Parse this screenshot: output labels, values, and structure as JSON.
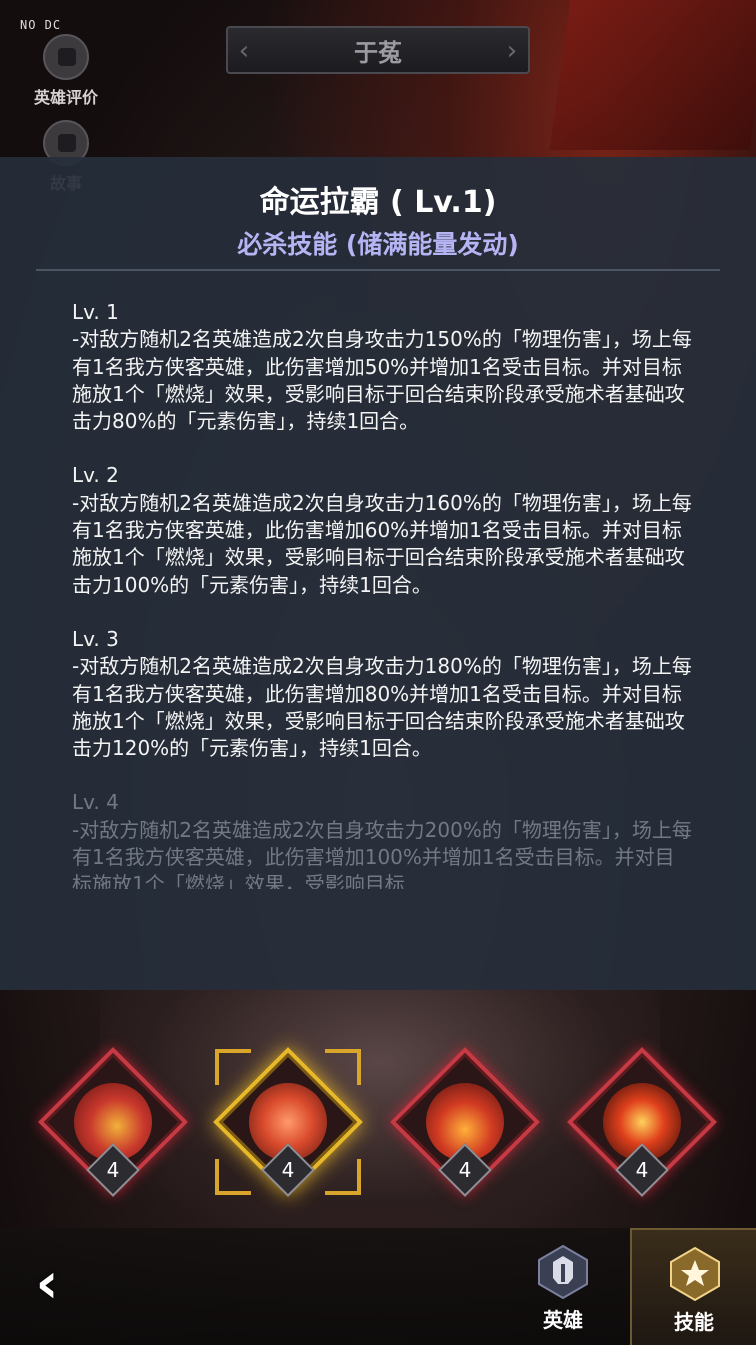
{
  "debug_tag": "NO DC",
  "side_buttons": {
    "rating_label": "英雄评价",
    "story_label": "故事"
  },
  "hero_name": "于菟",
  "skill": {
    "title": "命运拉霸 ( Lv.1)",
    "subtitle": "必杀技能 (储满能量发动)",
    "levels": [
      {
        "lv": "Lv. 1",
        "desc": "-对敌方随机2名英雄造成2次自身攻击力150%的「物理伤害」，场上每有1名我方侠客英雄，此伤害增加50%并增加1名受击目标。并对目标施放1个「燃烧」效果，受影响目标于回合结束阶段承受施术者基础攻击力80%的「元素伤害」，持续1回合。"
      },
      {
        "lv": "Lv. 2",
        "desc": "-对敌方随机2名英雄造成2次自身攻击力160%的「物理伤害」，场上每有1名我方侠客英雄，此伤害增加60%并增加1名受击目标。并对目标施放1个「燃烧」效果，受影响目标于回合结束阶段承受施术者基础攻击力100%的「元素伤害」，持续1回合。"
      },
      {
        "lv": "Lv. 3",
        "desc": "-对敌方随机2名英雄造成2次自身攻击力180%的「物理伤害」，场上每有1名我方侠客英雄，此伤害增加80%并增加1名受击目标。并对目标施放1个「燃烧」效果，受影响目标于回合结束阶段承受施术者基础攻击力120%的「元素伤害」，持续1回合。"
      },
      {
        "lv": "Lv. 4",
        "desc": "-对敌方随机2名英雄造成2次自身攻击力200%的「物理伤害」，场上每有1名我方侠客英雄，此伤害增加100%并增加1名受击目标。并对目标施放1个「燃烧」效果，受影响目标"
      }
    ]
  },
  "skill_icons": [
    {
      "name": "coins",
      "count": "4",
      "selected": false,
      "color": "#c8372c"
    },
    {
      "name": "slot-machine",
      "count": "4",
      "selected": true,
      "color": "#d94a2c"
    },
    {
      "name": "whisk-bowl",
      "count": "4",
      "selected": false,
      "color": "#d13a22"
    },
    {
      "name": "tiger-face",
      "count": "4",
      "selected": false,
      "color": "#e0401c"
    }
  ],
  "bottom_tabs": {
    "hero_label": "英雄",
    "skill_label": "技能"
  }
}
